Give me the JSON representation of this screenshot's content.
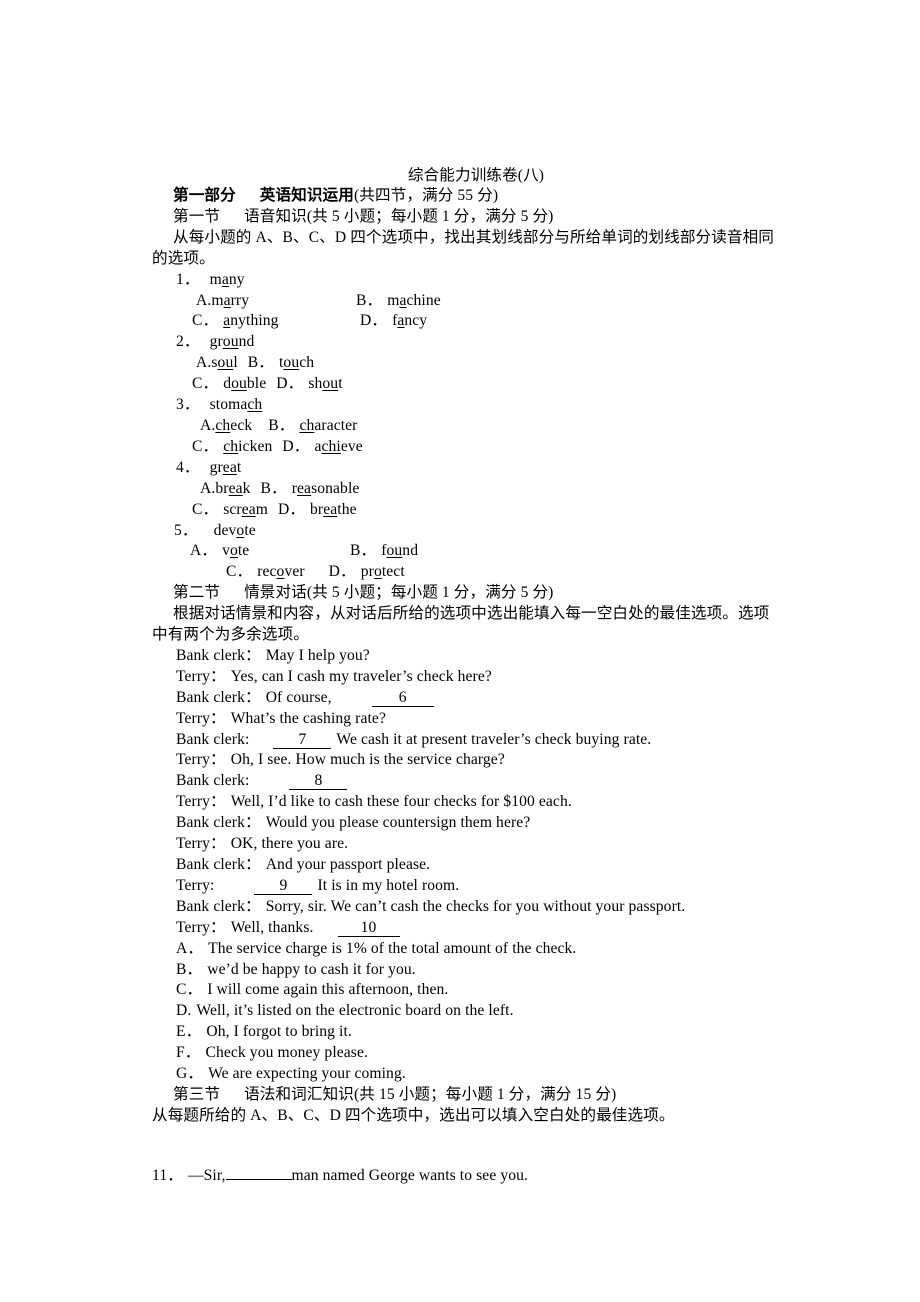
{
  "document": {
    "title": "综合能力训练卷(八)",
    "part_one": {
      "heading_bold": "第一部分",
      "heading_rest": "英语知识运用",
      "heading_paren": "(共四节，满分 55 分)"
    },
    "section_one": {
      "label": "第一节",
      "name": "语音知识",
      "paren": "(共 5 小题；每小题 1 分，满分 5 分)",
      "instruction": "从每小题的 A、B、C、D 四个选项中，找出其划线部分与所给单词的划线部分读音相同的选项。",
      "questions": [
        {
          "num": "1．",
          "stem_pre": "m",
          "stem_u": "a",
          "stem_post": "ny",
          "a_label": "A.",
          "a_pre": "m",
          "a_u": "a",
          "a_post": "rry",
          "b_label": "B．",
          "b_pre": "m",
          "b_u": "a",
          "b_post": "chine",
          "c_label": "C．",
          "c_pre": "",
          "c_u": "a",
          "c_post": "nything",
          "d_label": "D．",
          "d_pre": "f",
          "d_u": "a",
          "d_post": "ncy"
        },
        {
          "num": "2．",
          "stem_pre": "gr",
          "stem_u": "ou",
          "stem_post": "nd",
          "a_label": "A.",
          "a_pre": "s",
          "a_u": "ou",
          "a_post": "l",
          "b_label": "B．",
          "b_pre": "t",
          "b_u": "ou",
          "b_post": "ch",
          "c_label": "C．",
          "c_pre": "d",
          "c_u": "ou",
          "c_post": "ble",
          "d_label": "D．",
          "d_pre": "sh",
          "d_u": "ou",
          "d_post": "t"
        },
        {
          "num": "3．",
          "stem_pre": "stoma",
          "stem_u": "ch",
          "stem_post": "",
          "a_label": "A.",
          "a_pre": "",
          "a_u": "ch",
          "a_post": "eck",
          "b_label": "B．",
          "b_pre": "",
          "b_u": "ch",
          "b_post": "aracter",
          "c_label": "C．",
          "c_pre": "",
          "c_u": "ch",
          "c_post": "icken",
          "d_label": "D．",
          "d_pre": "a",
          "d_u": "chi",
          "d_post": "eve"
        },
        {
          "num": "4．",
          "stem_pre": "gr",
          "stem_u": "ea",
          "stem_post": "t",
          "a_label": "A.",
          "a_pre": "br",
          "a_u": "ea",
          "a_post": "k",
          "b_label": "B．",
          "b_pre": "r",
          "b_u": "ea",
          "b_post": "sonable",
          "c_label": "C．",
          "c_pre": "scr",
          "c_u": "ea",
          "c_post": "m",
          "d_label": "D．",
          "d_pre": "br",
          "d_u": "ea",
          "d_post": "the"
        },
        {
          "num": "5．",
          "stem_pre": "dev",
          "stem_u": "o",
          "stem_post": "te",
          "a_label": "A．",
          "a_pre": "v",
          "a_u": "o",
          "a_post": "te",
          "b_label": "B．",
          "b_pre": "f",
          "b_u": "ou",
          "b_post": "nd",
          "c_label": "C．",
          "c_pre": "rec",
          "c_u": "o",
          "c_post": "ver",
          "d_label": "D．",
          "d_pre": "pr",
          "d_u": "o",
          "d_post": "tect"
        }
      ]
    },
    "section_two": {
      "label": "第二节",
      "name": "情景对话",
      "paren": "(共 5 小题；每小题 1 分，满分 5 分)",
      "instruction": "根据对话情景和内容，从对话后所给的选项中选出能填入每一空白处的最佳选项。选项中有两个为多余选项。",
      "dialogue": [
        {
          "speaker": "Bank clerk：",
          "text": "May I help you?",
          "blank": null,
          "after": ""
        },
        {
          "speaker": "Terry：",
          "text": "Yes, can I cash my traveler’s check here?",
          "blank": null,
          "after": ""
        },
        {
          "speaker": "Bank clerk：",
          "text": "Of course,",
          "blank": "6",
          "after": ""
        },
        {
          "speaker": "Terry：",
          "text": "What’s the cashing rate?",
          "blank": null,
          "after": ""
        },
        {
          "speaker": "Bank clerk:",
          "text": "",
          "blank": "7",
          "after": "We cash it at present traveler’s check buying rate."
        },
        {
          "speaker": "Terry：",
          "text": "Oh, I see. How much is the service charge?",
          "blank": null,
          "after": ""
        },
        {
          "speaker": "Bank clerk:",
          "text": "",
          "blank": "8",
          "after": ""
        },
        {
          "speaker": "Terry：",
          "text": "Well, I’d like to cash these four checks for $100 each.",
          "blank": null,
          "after": ""
        },
        {
          "speaker": "Bank clerk：",
          "text": "Would you please countersign them here?",
          "blank": null,
          "after": ""
        },
        {
          "speaker": "Terry：",
          "text": "OK, there you are.",
          "blank": null,
          "after": ""
        },
        {
          "speaker": "Bank clerk：",
          "text": "And your passport please.",
          "blank": null,
          "after": ""
        },
        {
          "speaker": "Terry:",
          "text": "",
          "blank": "9",
          "after": "It is in my hotel room."
        },
        {
          "speaker": "Bank clerk：",
          "text": "Sorry, sir. We can’t cash the checks for you without your passport.",
          "blank": null,
          "after": ""
        },
        {
          "speaker": "Terry：",
          "text": "Well, thanks.",
          "blank": "10",
          "after": ""
        }
      ],
      "options": [
        {
          "label": "A．",
          "text": "The service charge is 1% of the total amount of the check."
        },
        {
          "label": "B．",
          "text": "we’d be happy to cash it for you."
        },
        {
          "label": "C．",
          "text": "I will come again this afternoon, then."
        },
        {
          "label": "D.",
          "text": "Well, it’s listed on the electronic board on the left."
        },
        {
          "label": "E．",
          "text": "Oh, I forgot to bring it."
        },
        {
          "label": "F．",
          "text": "Check you money please."
        },
        {
          "label": "G．",
          "text": "We are expecting your coming."
        }
      ]
    },
    "section_three": {
      "label": "第三节",
      "name": "语法和词汇知识",
      "paren": "(共 15 小题；每小题 1 分，满分 15 分)",
      "instruction": "从每题所给的 A、B、C、D 四个选项中，选出可以填入空白处的最佳选项。",
      "question_11": {
        "num": "11．",
        "pre": "—Sir,",
        "post": "man named George wants to see you."
      }
    }
  }
}
